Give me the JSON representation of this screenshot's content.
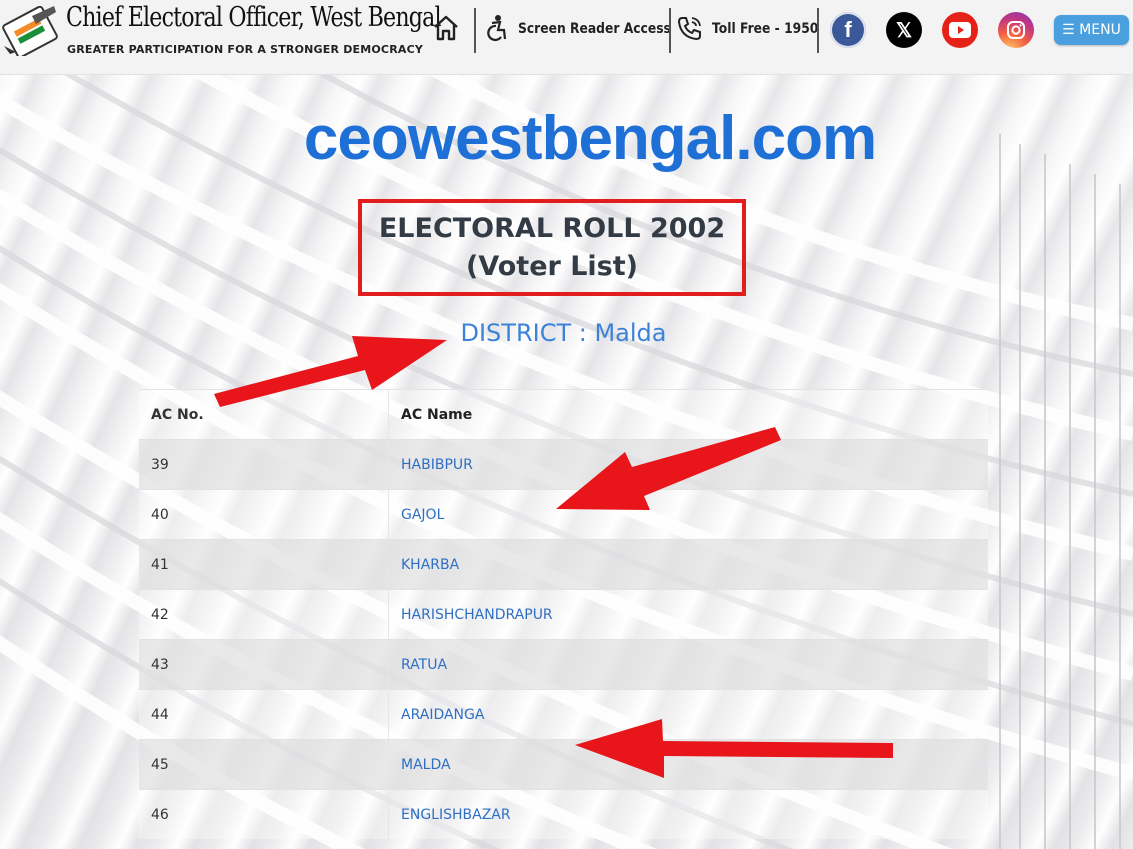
{
  "header": {
    "title": "Chief Electoral Officer, West Bengal",
    "tagline": "GREATER PARTICIPATION FOR A STRONGER DEMOCRACY",
    "screen_reader": "Screen Reader Access",
    "toll_free": "Toll Free - 1950",
    "menu_label": "☰ MENU",
    "icons": [
      "home-icon",
      "accessibility-icon",
      "phone-icon",
      "facebook-icon",
      "x-icon",
      "youtube-icon",
      "instagram-icon"
    ]
  },
  "main": {
    "site_name": "ceowestbengal.com",
    "roll_title": "ELECTORAL ROLL 2002",
    "roll_subtitle": "(Voter List)",
    "district": "DISTRICT : Malda",
    "table": {
      "headers": [
        "AC No.",
        "AC Name"
      ],
      "rows": [
        {
          "no": "39",
          "name": "HABIBPUR"
        },
        {
          "no": "40",
          "name": "GAJOL"
        },
        {
          "no": "41",
          "name": "KHARBA"
        },
        {
          "no": "42",
          "name": "HARISHCHANDRAPUR"
        },
        {
          "no": "43",
          "name": "RATUA"
        },
        {
          "no": "44",
          "name": "ARAIDANGA"
        },
        {
          "no": "45",
          "name": "MALDA"
        },
        {
          "no": "46",
          "name": "ENGLISHBAZAR"
        }
      ]
    }
  },
  "colors": {
    "site_name": "#1e6fd6",
    "annotation": "#e21d1d",
    "link": "#2e6fc4",
    "menu": "#4aa0de",
    "facebook": "#3b5998",
    "youtube": "#e62117"
  }
}
